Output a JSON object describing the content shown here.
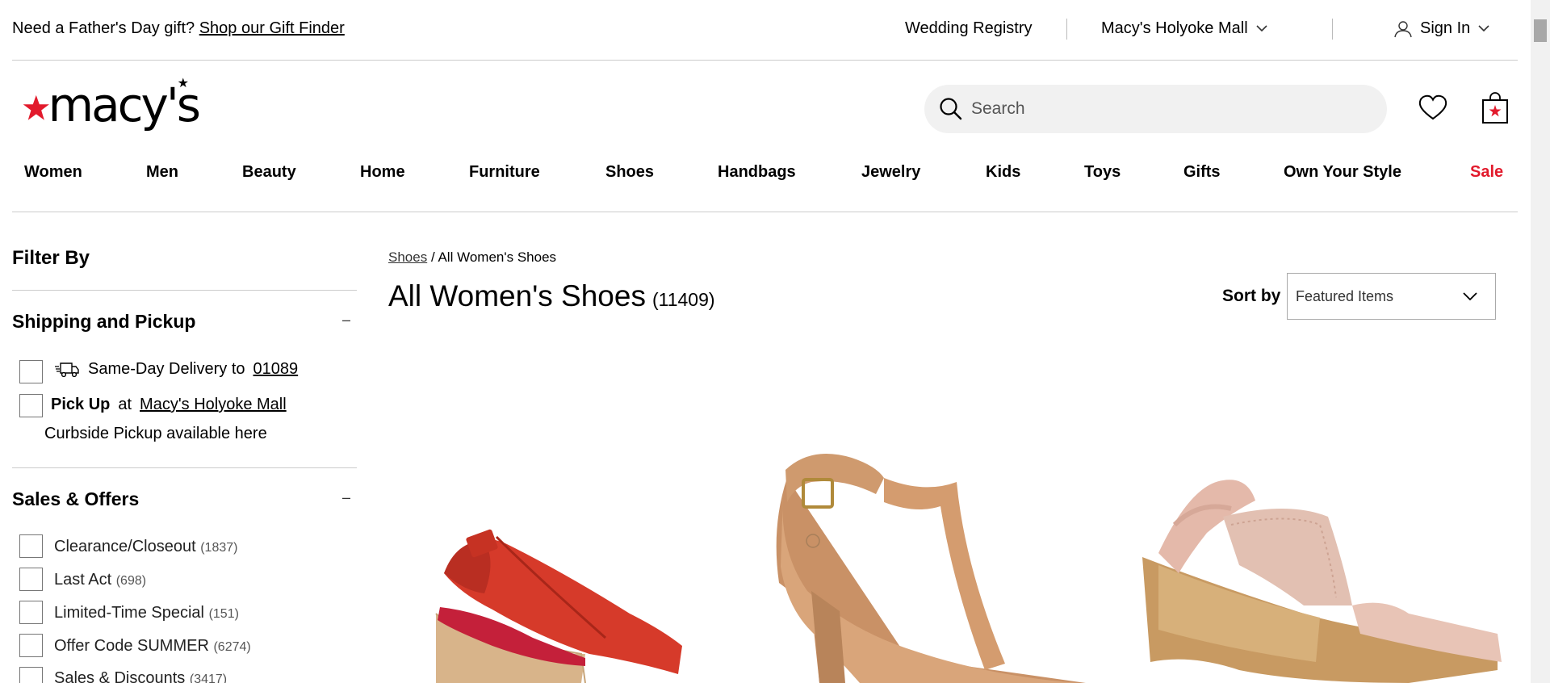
{
  "utility": {
    "promo_text": "Need a Father's Day gift?",
    "promo_link": "Shop our Gift Finder",
    "wedding_registry": "Wedding Registry",
    "store_name": "Macy's Holyoke Mall",
    "sign_in": "Sign In"
  },
  "header": {
    "logo_text": "macy's",
    "search_placeholder": "Search"
  },
  "nav": {
    "items": [
      "Women",
      "Men",
      "Beauty",
      "Home",
      "Furniture",
      "Shoes",
      "Handbags",
      "Jewelry",
      "Kids",
      "Toys",
      "Gifts",
      "Own Your Style",
      "Sale"
    ]
  },
  "filters": {
    "title": "Filter By",
    "shipping": {
      "title": "Shipping and Pickup",
      "collapse_symbol": "–",
      "same_day_label": "Same-Day Delivery to",
      "zip": "01089",
      "pickup_label": "Pick Up",
      "pickup_at": "at",
      "pickup_store": "Macy's Holyoke Mall",
      "curbside": "Curbside Pickup available here"
    },
    "sales": {
      "title": "Sales & Offers",
      "collapse_symbol": "–",
      "options": [
        {
          "label": "Clearance/Closeout",
          "count": "(1837)"
        },
        {
          "label": "Last Act",
          "count": "(698)"
        },
        {
          "label": "Limited-Time Special",
          "count": "(151)"
        },
        {
          "label": "Offer Code SUMMER",
          "count": "(6274)"
        },
        {
          "label": "Sales & Discounts",
          "count": "(3417)"
        }
      ]
    }
  },
  "content": {
    "breadcrumb_parent": "Shoes",
    "breadcrumb_sep": "/",
    "breadcrumb_current": "All Women's Shoes",
    "title": "All Women's Shoes",
    "total": "(11409)",
    "sort_label": "Sort by",
    "sort_value": "Featured Items"
  },
  "colors": {
    "brand_red": "#e21a2c",
    "sale_red": "#e21a2c"
  }
}
